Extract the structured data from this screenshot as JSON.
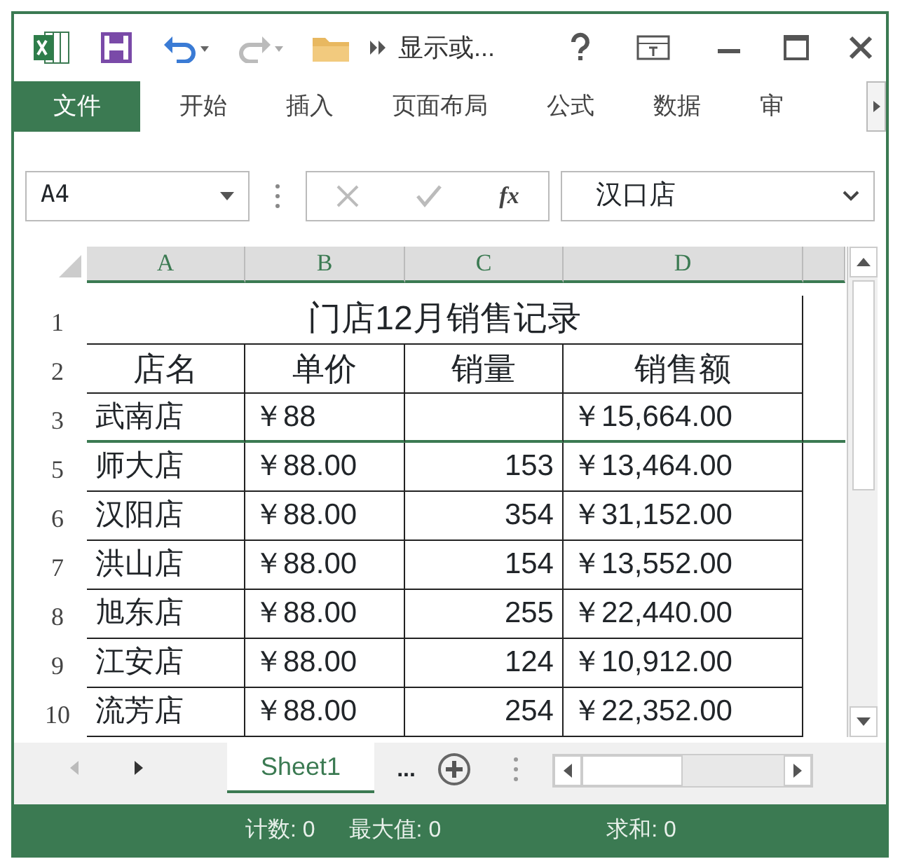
{
  "quick_access": {
    "title": "显示或...",
    "undo_enabled": true,
    "redo_enabled": false
  },
  "ribbon_tabs": [
    {
      "label": "文件",
      "selected": true
    },
    {
      "label": "开始",
      "selected": false
    },
    {
      "label": "插入",
      "selected": false
    },
    {
      "label": "页面布局",
      "selected": false
    },
    {
      "label": "公式",
      "selected": false
    },
    {
      "label": "数据",
      "selected": false
    },
    {
      "label": "审",
      "selected": false
    }
  ],
  "formula_bar": {
    "name_box": "A4",
    "fx": "fx",
    "value": "汉口店",
    "cancel_enabled": false,
    "enter_enabled": false
  },
  "sheet": {
    "columns": [
      "A",
      "B",
      "C",
      "D"
    ],
    "title_row": {
      "header": "1",
      "text": "门店12月销售记录"
    },
    "rows": [
      {
        "header": "2",
        "cells": [
          "店名",
          "单价",
          "销量",
          "销售额"
        ],
        "kind": "heading",
        "hidden_row_below": false
      },
      {
        "header": "3",
        "cells": [
          "武南店",
          "￥88",
          "",
          "￥15,664.00"
        ],
        "kind": "data",
        "hidden_row_below": true
      },
      {
        "header": "5",
        "cells": [
          "师大店",
          "￥88.00",
          "153",
          "￥13,464.00"
        ],
        "kind": "data",
        "hidden_row_below": false
      },
      {
        "header": "6",
        "cells": [
          "汉阳店",
          "￥88.00",
          "354",
          "￥31,152.00"
        ],
        "kind": "data",
        "hidden_row_below": false
      },
      {
        "header": "7",
        "cells": [
          "洪山店",
          "￥88.00",
          "154",
          "￥13,552.00"
        ],
        "kind": "data",
        "hidden_row_below": false
      },
      {
        "header": "8",
        "cells": [
          "旭东店",
          "￥88.00",
          "255",
          "￥22,440.00"
        ],
        "kind": "data",
        "hidden_row_below": false
      },
      {
        "header": "9",
        "cells": [
          "江安店",
          "￥88.00",
          "124",
          "￥10,912.00"
        ],
        "kind": "data",
        "hidden_row_below": false
      },
      {
        "header": "10",
        "cells": [
          "流芳店",
          "￥88.00",
          "254",
          "￥22,352.00"
        ],
        "kind": "data",
        "hidden_row_below": false
      }
    ]
  },
  "sheet_tabs": [
    {
      "label": "Sheet1",
      "selected": true
    }
  ],
  "more_sheets": "...",
  "status_bar": [
    "计数: 0",
    "最大值: 0",
    "求和: 0"
  ]
}
